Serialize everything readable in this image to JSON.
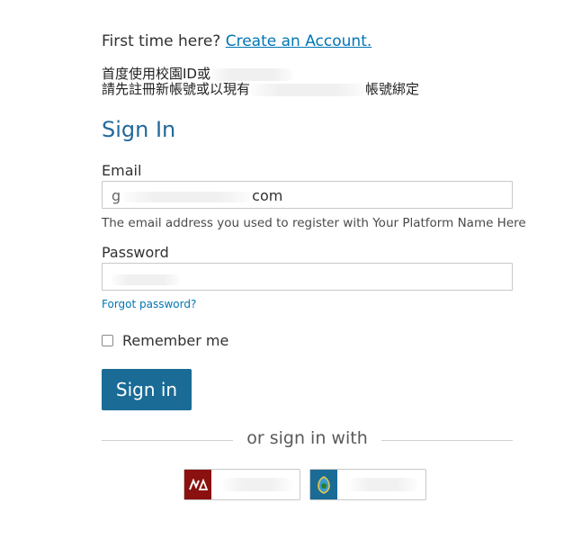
{
  "intro": {
    "prefix": "First time here?",
    "create_link": "Create an Account."
  },
  "notice": {
    "line1": "首度使用校園ID或",
    "line2_start": "請先註冊新帳號或以現有",
    "line2_end": "帳號綁定"
  },
  "signin": {
    "heading": "Sign In",
    "email_label": "Email",
    "email_value_prefix": "g",
    "email_value_suffix": "com",
    "email_help": "The email address you used to register with Your Platform Name Here",
    "password_label": "Password",
    "forgot_link": "Forgot password?",
    "remember_label": "Remember me",
    "remember_checked": false,
    "submit_label": "Sign in"
  },
  "alt_signin": {
    "divider_text": "or sign in with",
    "providers": [
      {
        "icon": "ntu-logo-icon",
        "color": "#8b1010"
      },
      {
        "icon": "shield-logo-icon",
        "color": "#1a6b96"
      }
    ]
  }
}
